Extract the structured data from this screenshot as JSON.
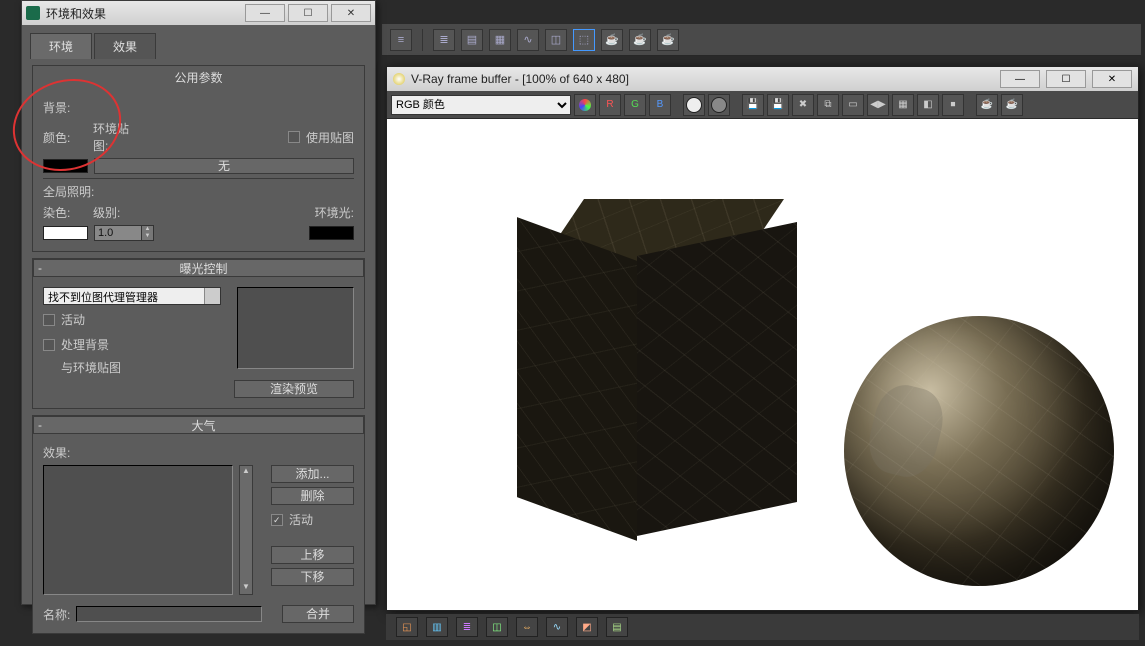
{
  "env_dialog": {
    "title": "环境和效果",
    "tabs": {
      "environment": "环境",
      "effects": "效果"
    },
    "common": {
      "header": "公用参数",
      "background_label": "背景:",
      "color_label": "颜色:",
      "env_map_label": "环境贴图:",
      "use_map_label": "使用贴图",
      "use_map_checked": false,
      "map_btn": "无",
      "global_illum_label": "全局照明:",
      "tint_label": "染色:",
      "level_label": "级别:",
      "level_value": "1.0",
      "ambient_label": "环境光:"
    },
    "exposure": {
      "header": "曝光控制",
      "dropdown_value": "找不到位图代理管理器",
      "active_label": "活动",
      "process_bg_label": "处理背景",
      "and_env_map_label": "与环境贴图",
      "render_preview_btn": "渲染预览"
    },
    "atmosphere": {
      "header": "大气",
      "effects_label": "效果:",
      "add_btn": "添加...",
      "delete_btn": "删除",
      "active_label": "活动",
      "active_checked": true,
      "move_up_btn": "上移",
      "move_down_btn": "下移",
      "name_label": "名称:",
      "merge_btn": "合并"
    }
  },
  "vfb": {
    "title": "V-Ray frame buffer - [100% of 640 x 480]",
    "channel_dropdown": "RGB 颜色"
  },
  "colors": {
    "bg_color": "#000000",
    "tint_color": "#ffffff",
    "ambient_color": "#000000"
  }
}
